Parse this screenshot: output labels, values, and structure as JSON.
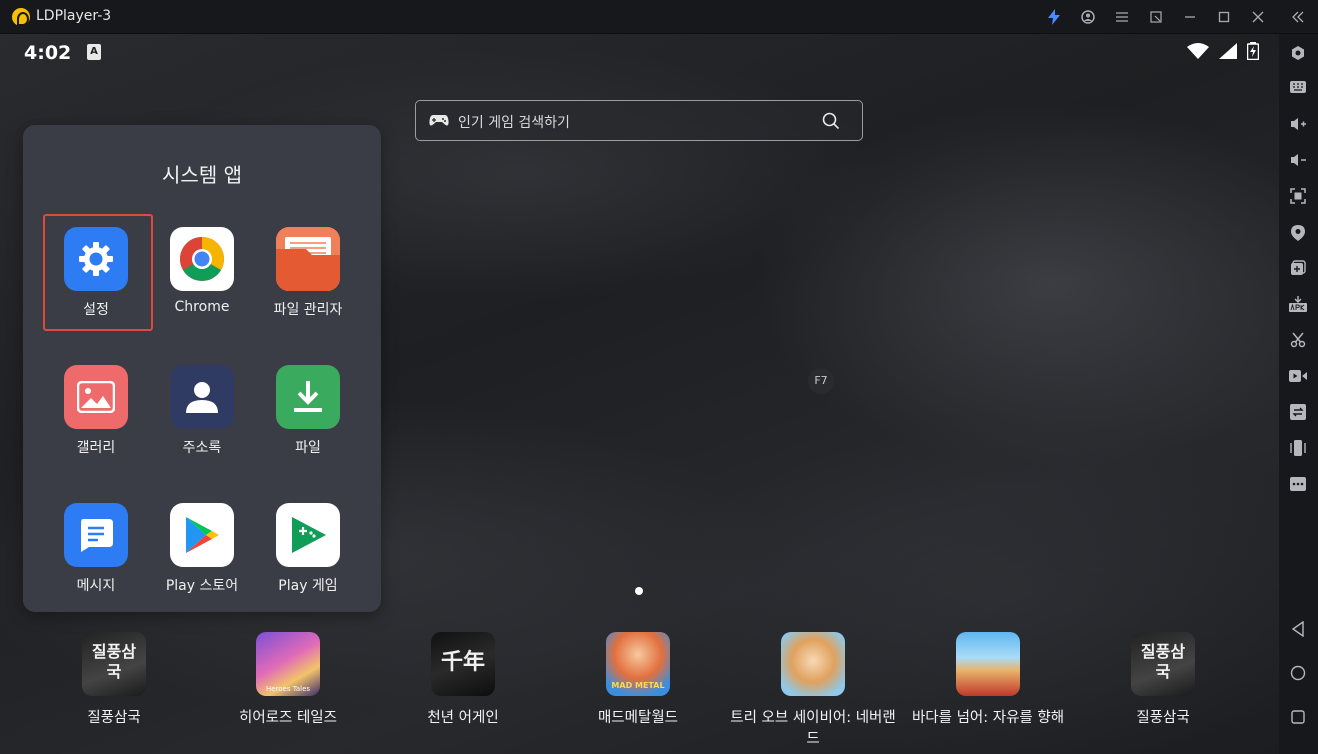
{
  "window": {
    "title": "LDPlayer-3"
  },
  "titlebar_icons": [
    "bolt-icon",
    "account-icon",
    "menu-icon",
    "popout-icon",
    "minimize-icon",
    "maximize-icon",
    "close-icon",
    "collapse-icon"
  ],
  "status": {
    "time": "4:02",
    "notification": "A"
  },
  "search": {
    "placeholder": "인기 게임 검색하기"
  },
  "folder": {
    "title": "시스템 앱",
    "apps": [
      {
        "label": "설정",
        "icon": "settings-icon",
        "selected": true
      },
      {
        "label": "Chrome",
        "icon": "chrome-icon"
      },
      {
        "label": "파일 관리자",
        "icon": "file-manager-icon"
      },
      {
        "label": "갤러리",
        "icon": "gallery-icon"
      },
      {
        "label": "주소록",
        "icon": "contacts-icon"
      },
      {
        "label": "파일",
        "icon": "download-icon"
      },
      {
        "label": "메시지",
        "icon": "messages-icon"
      },
      {
        "label": "Play 스토어",
        "icon": "play-store-icon"
      },
      {
        "label": "Play 게임",
        "icon": "play-games-icon"
      }
    ]
  },
  "hint": {
    "key": "F7"
  },
  "dock": [
    {
      "label": "질풍삼국",
      "icon_text": "질풍삼국"
    },
    {
      "label": "히어로즈 테일즈",
      "icon_text": "Heroes Tales"
    },
    {
      "label": "천년 어게인",
      "icon_text": "千年"
    },
    {
      "label": "매드메탈월드",
      "icon_text": "MAD METAL"
    },
    {
      "label": "트리 오브 세이비어: 네버랜드",
      "icon_text": ""
    },
    {
      "label": "바다를 넘어: 자유를 향해",
      "icon_text": ""
    },
    {
      "label": "질풍삼국",
      "icon_text": "질풍삼국"
    }
  ],
  "sidebar_icons": [
    "settings-gear-icon",
    "keyboard-icon",
    "volume-up-icon",
    "volume-down-icon",
    "screenshot-icon",
    "location-icon",
    "multi-instance-icon",
    "apk-install-icon",
    "scissors-icon",
    "record-icon",
    "sync-icon",
    "shake-icon",
    "more-icon",
    "back-icon",
    "home-icon",
    "recents-icon"
  ],
  "colors": {
    "accent": "#2a7cf6",
    "selection": "#e04a3a",
    "logo": "#f6c000"
  }
}
